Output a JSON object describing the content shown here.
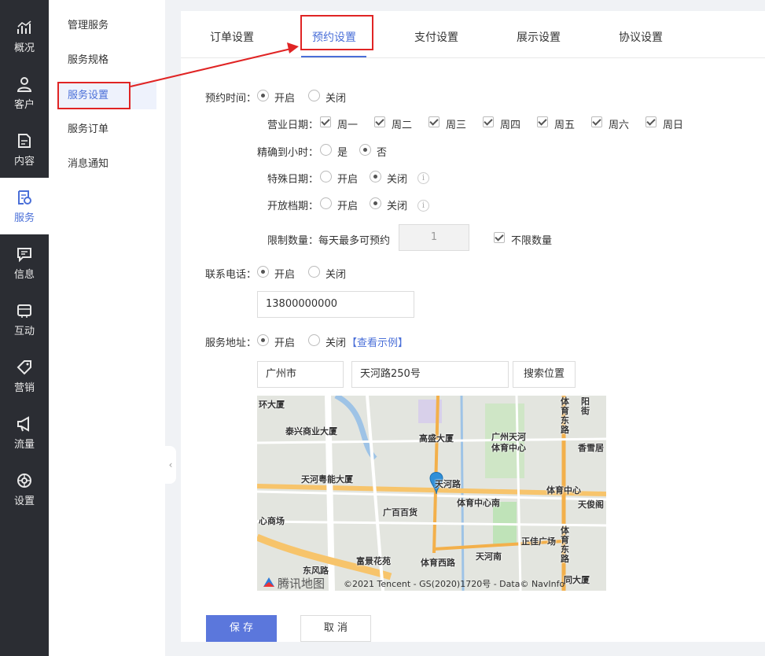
{
  "nav": {
    "items": [
      {
        "label": "概况",
        "icon": "chart-icon"
      },
      {
        "label": "客户",
        "icon": "user-icon"
      },
      {
        "label": "内容",
        "icon": "document-icon"
      },
      {
        "label": "服务",
        "icon": "service-icon"
      },
      {
        "label": "信息",
        "icon": "message-icon"
      },
      {
        "label": "互动",
        "icon": "interact-icon"
      },
      {
        "label": "营销",
        "icon": "tag-icon"
      },
      {
        "label": "流量",
        "icon": "megaphone-icon"
      },
      {
        "label": "设置",
        "icon": "gear-icon"
      }
    ],
    "active_color": "#4a6fd8"
  },
  "subnav": {
    "items": [
      "管理服务",
      "服务规格",
      "服务设置",
      "服务订单",
      "消息通知"
    ]
  },
  "tabs": [
    "订单设置",
    "预约设置",
    "支付设置",
    "展示设置",
    "协议设置"
  ],
  "form": {
    "reserve_time": {
      "label": "预约时间：",
      "on": "开启",
      "off": "关闭"
    },
    "business_days": {
      "label": "营业日期：",
      "days": [
        "周一",
        "周二",
        "周三",
        "周四",
        "周五",
        "周六",
        "周日"
      ]
    },
    "exact_hour": {
      "label": "精确到小时：",
      "yes": "是",
      "no": "否"
    },
    "special_date": {
      "label": "特殊日期：",
      "on": "开启",
      "off": "关闭",
      "info": "i"
    },
    "open_schedule": {
      "label": "开放档期：",
      "on": "开启",
      "off": "关闭",
      "info": "i"
    },
    "limit": {
      "label": "限制数量：每天最多可预约",
      "value": "1",
      "unlimited": "不限数量"
    },
    "phone": {
      "label": "联系电话：",
      "on": "开启",
      "off": "关闭",
      "value": "13800000000"
    },
    "address": {
      "label": "服务地址：",
      "on": "开启",
      "off": "关闭",
      "example": "【查看示例】",
      "city": "广州市",
      "street": "天河路250号",
      "search": "搜索位置"
    }
  },
  "map": {
    "labels": [
      "环大厦",
      "泰兴商业大厦",
      "高盛大厦",
      "广州天河",
      "体育中心",
      "体育东路",
      "阳街",
      "香雪居",
      "天河粤能大厦",
      "天河路",
      "体育中心南",
      "体育中心",
      "天俊阁",
      "心商场",
      "广百百货",
      "正佳广场",
      "体育东路",
      "富景花苑",
      "体育西路",
      "天河南",
      "东风路",
      "同大厦"
    ],
    "logo": "腾讯地图",
    "copyright": "©2021 Tencent - GS(2020)1720号 - Data© NavInfo"
  },
  "buttons": {
    "save": "保 存",
    "cancel": "取 消"
  }
}
